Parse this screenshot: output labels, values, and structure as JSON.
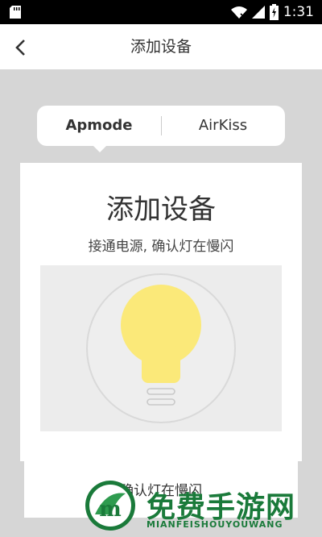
{
  "status_bar": {
    "time": "1:31"
  },
  "nav": {
    "title": "添加设备"
  },
  "tabs": [
    {
      "label": "Apmode"
    },
    {
      "label": "AirKiss"
    }
  ],
  "card": {
    "title": "添加设备",
    "subtitle": "接通电源, 确认灯在慢闪"
  },
  "card2": {
    "text": "确认灯在慢闪"
  },
  "watermark": {
    "title": "免费手游网",
    "subtitle": "MIANFEISHOUYOUWANG"
  },
  "colors": {
    "bulb": "#fbe979",
    "accent": "#1a7a3a"
  }
}
